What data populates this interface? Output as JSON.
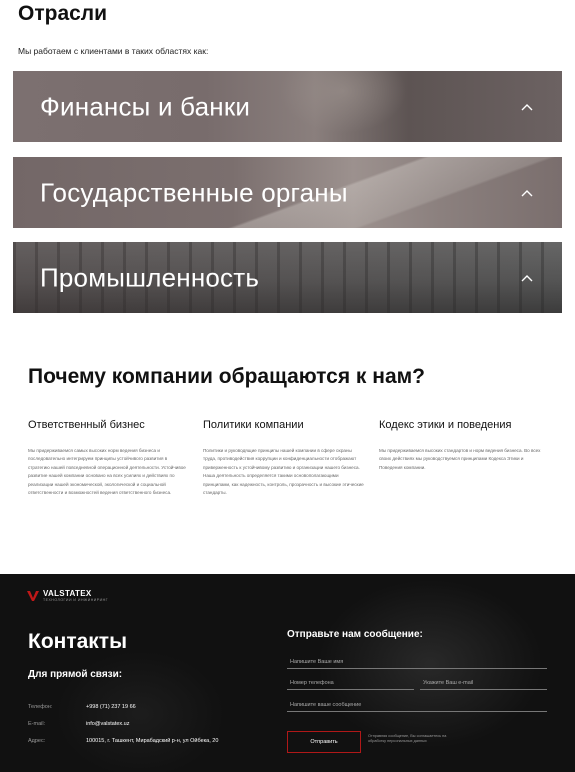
{
  "industries": {
    "title": "Отрасли",
    "intro": "Мы работаем с клиентами в таких областях как:",
    "items": [
      {
        "label": "Финансы и банки"
      },
      {
        "label": "Государственные органы"
      },
      {
        "label": "Промышленность"
      }
    ]
  },
  "why": {
    "title": "Почему компании обращаются к нам?",
    "columns": [
      {
        "heading": "Ответственный бизнес",
        "text": "Мы придерживаемся самых высоких норм ведения бизнеса и последовательно интегрируем принципы устойчивого развития в стратегию нашей повседневной операционной деятельности. Устойчивое развитие нашей компании основано на всех усилиях и действиях по реализации нашей экономической, экологической и социальной ответственности и возможностей ведения ответственного бизнеса."
      },
      {
        "heading": "Политики компании",
        "text": "Политики и руководящие принципы нашей компании в сфере охраны труда, противодействия коррупции и конфиденциальности отображают приверженность к устойчивому развитию и организации нашего бизнеса. Наша деятельность определяется такими основополагающими принципами, как надежность, контроль, прозрачность и высокие этические стандарты."
      },
      {
        "heading": "Кодекс этики и поведения",
        "text": "Мы придерживаемся высоких стандартов и норм ведения бизнеса. Во всех своих действиях мы руководствуемся принципами Кодекса Этики и Поведения компании."
      }
    ]
  },
  "footer": {
    "logo_text": "VALSTATEX",
    "logo_sub": "ТЕХНОЛОГИИ И ИНЖИНИРИНГ",
    "contacts_title": "Контакты",
    "direct_title": "Для прямой связи:",
    "phone_label": "Телефон:",
    "phone_value": "+998 (71) 237 19 66",
    "email_label": "E-mail:",
    "email_value": "info@valstatex.uz",
    "address_label": "Адрес:",
    "address_value": "100015, г. Ташкент, Мирабадский р-н, ул Ойбека, 20",
    "form": {
      "title": "Отправьте нам сообщение:",
      "name_placeholder": "Напишите Ваше имя",
      "phone_placeholder": "Номер телефона",
      "email_placeholder": "Укажите Ваш e-mail",
      "message_placeholder": "Напишите ваше сообщение",
      "submit_label": "Отправить",
      "consent_text": "Отправляя сообщение, Вы соглашаетесь на обработку персональных данных"
    }
  },
  "colors": {
    "accent": "#b01818",
    "footer_bg": "#111111"
  },
  "icons": {
    "industry_toggle": "chevron-up-icon",
    "logo": "valstatex-logo-icon"
  }
}
